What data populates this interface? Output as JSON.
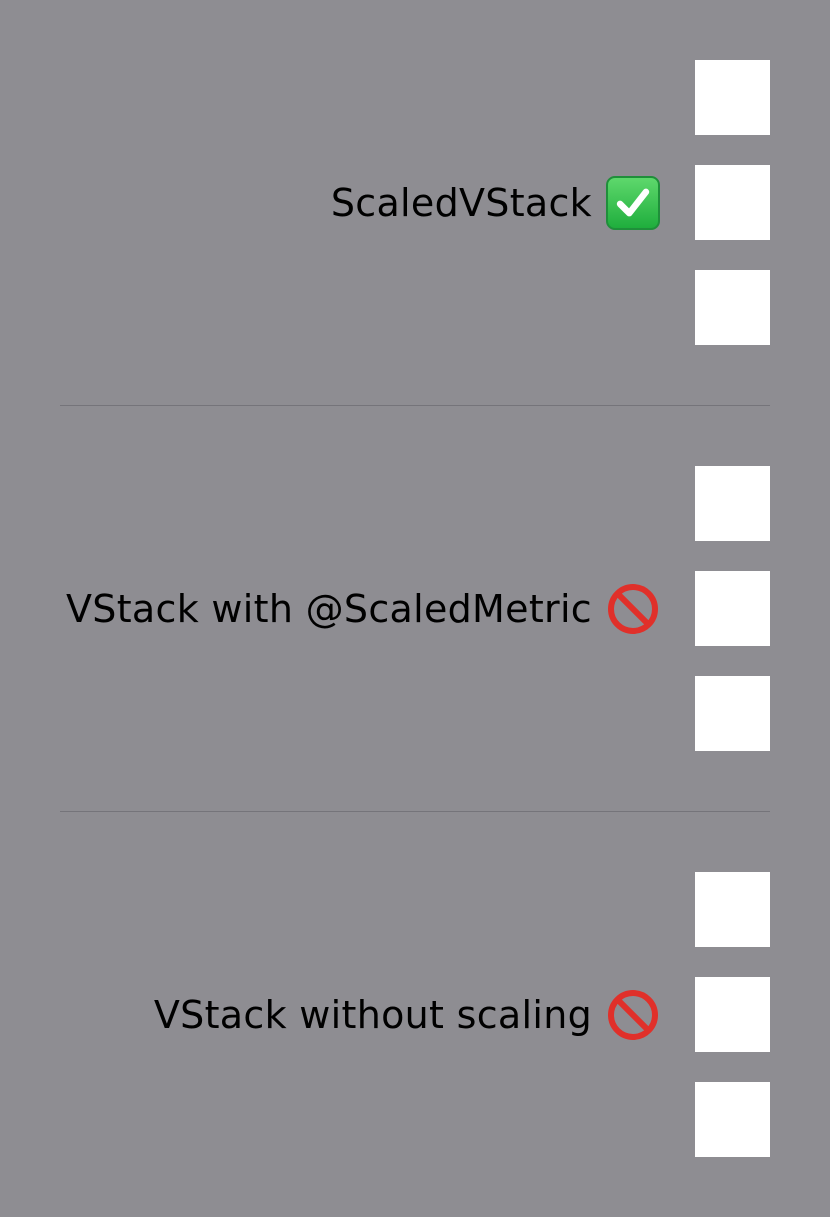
{
  "rows": [
    {
      "label": "ScaledVStack",
      "status_icon": "check-mark-button-icon"
    },
    {
      "label": "VStack with @ScaledMetric",
      "status_icon": "prohibited-icon"
    },
    {
      "label": "VStack without scaling",
      "status_icon": "prohibited-icon"
    }
  ],
  "colors": {
    "background": "#8e8d92",
    "square": "#ffffff",
    "divider": "#75747a",
    "check": "#34c759",
    "prohibited": "#e0302a"
  }
}
